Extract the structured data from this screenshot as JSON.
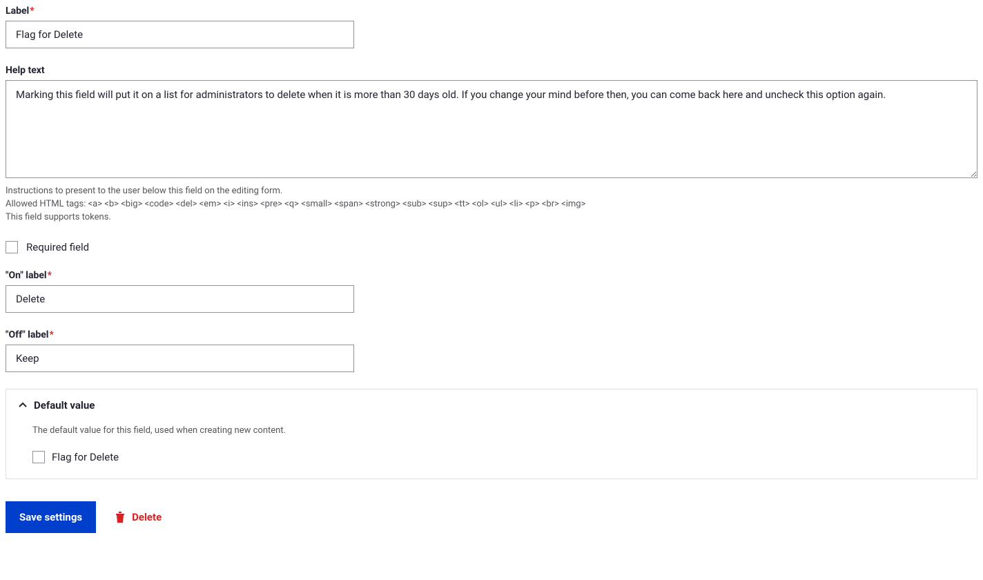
{
  "labelField": {
    "label": "Label",
    "value": "Flag for Delete",
    "required": true
  },
  "helpText": {
    "label": "Help text",
    "value": "Marking this field will put it on a list for administrators to delete when it is more than 30 days old. If you change your mind before then, you can come back here and uncheck this option again.",
    "desc1": "Instructions to present to the user below this field on the editing form.",
    "desc2": "Allowed HTML tags: <a> <b> <big> <code> <del> <em> <i> <ins> <pre> <q> <small> <span> <strong> <sub> <sup> <tt> <ol> <ul> <li> <p> <br> <img>",
    "desc3": "This field supports tokens."
  },
  "requiredField": {
    "label": "Required field",
    "checked": false
  },
  "onLabel": {
    "label": "\"On\" label",
    "value": "Delete",
    "required": true
  },
  "offLabel": {
    "label": "\"Off\" label",
    "value": "Keep",
    "required": true
  },
  "defaultValue": {
    "title": "Default value",
    "desc": "The default value for this field, used when creating new content.",
    "checkboxLabel": "Flag for Delete",
    "checked": false
  },
  "actions": {
    "save": "Save settings",
    "delete": "Delete"
  }
}
